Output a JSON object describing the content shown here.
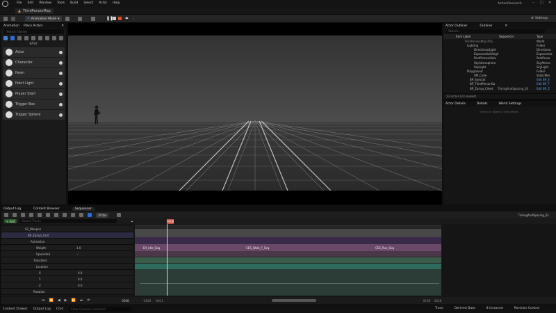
{
  "menu": {
    "items": [
      "File",
      "Edit",
      "Window",
      "Tools",
      "Build",
      "Select",
      "Actor",
      "Help"
    ],
    "project": "ActionResearch"
  },
  "level_tab": {
    "label": "ThirdPersonMap"
  },
  "toolbar": {
    "mode": "Animation Mode",
    "settings": "Settings"
  },
  "left_panel": {
    "tab_animation": "Animation",
    "tab_place": "Place Actors",
    "search_placeholder": "Search Classes",
    "section": "BASIC",
    "items": [
      "Actor",
      "Character",
      "Pawn",
      "Point Light",
      "Player Start",
      "Trigger Box",
      "Trigger Sphere"
    ]
  },
  "outliner": {
    "tab1": "Actor Outliner",
    "tab2": "Outliner",
    "search_placeholder": "Search...",
    "col_label": "Item Label",
    "col_sequencer": "Sequencer",
    "col_type": "Type",
    "rows": [
      {
        "label": "ThirdPersonMap (Pla",
        "type": "World"
      },
      {
        "label": "Lighting",
        "type": "Folder"
      },
      {
        "label": "DirectionalLight",
        "type": "Directiona"
      },
      {
        "label": "ExponentialHeigh",
        "type": "Exponentia"
      },
      {
        "label": "PostProcessVolu",
        "type": "PostProce"
      },
      {
        "label": "SkyAtmosphere",
        "type": "SkyAtmos"
      },
      {
        "label": "SkyLight",
        "type": "SkyLight"
      },
      {
        "label": "Playground",
        "type": "Folder"
      },
      {
        "label": "SM_Cube",
        "type": "StaticMes"
      },
      {
        "label": "BP_Spectat",
        "type": "Edit BP_S"
      },
      {
        "label": "BP_ThirdPersonGa",
        "type": "Edit BP_T"
      },
      {
        "label": "BP_Zariya_Client",
        "type": "Edit BP_Z"
      }
    ],
    "timing_label": "TimingAndSpacing_01",
    "count": "23 actors (23 loaded)"
  },
  "details": {
    "tab1": "Actor Details",
    "tab2": "Details",
    "tab3": "World Settings",
    "empty": "Select an object to view details."
  },
  "bottom_tabs": {
    "output": "Output Log",
    "content": "Content Browser",
    "sequencer": "Sequencer"
  },
  "sequencer": {
    "add": "+ Add",
    "fps": "30 fps",
    "search_placeholder": "Search Tracks",
    "frame": "0008",
    "sequence_name": "TimingAndSpacing_01",
    "tracks": [
      {
        "label": "02_Weapon",
        "value": ""
      },
      {
        "label": "BP_Zariya_Unit",
        "value": ""
      },
      {
        "label": "Animation",
        "value": ""
      },
      {
        "label": "Weight",
        "value": "1.0"
      },
      {
        "label": "Upwinded",
        "value": ""
      },
      {
        "label": "Transform",
        "value": ""
      },
      {
        "label": "Location",
        "value": ""
      },
      {
        "label": "X",
        "value": "0.0"
      },
      {
        "label": "Y",
        "value": "0.0"
      },
      {
        "label": "Z",
        "value": "0.0"
      },
      {
        "label": "Rotation",
        "value": ""
      }
    ],
    "clips": [
      "EA_Idle_Seq",
      "CES_Walk_F_Seq",
      "CES_Run_Seq"
    ],
    "range_start": "-0026",
    "range_end": "-0011",
    "range_right_a": "0198",
    "range_right_b": "0028"
  },
  "status": {
    "content_drawer": "Content Drawer",
    "output_log": "Output Log",
    "cmd": "Cmd",
    "console_placeholder": "Enter Console Command",
    "trace": "Trace",
    "derived": "Derived Data",
    "unsaved": "8 Unsaved",
    "revision": "Revision Control"
  }
}
